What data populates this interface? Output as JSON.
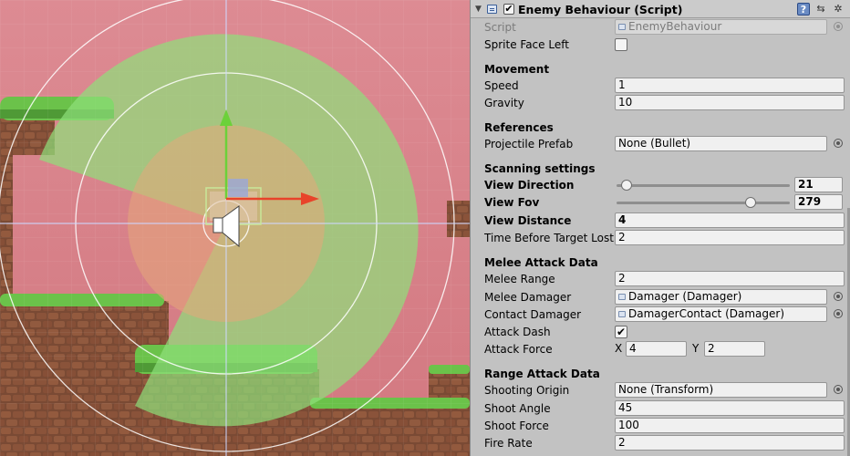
{
  "component": {
    "title": "Enemy Behaviour (Script)",
    "enabled": "✔",
    "help_icon": "?",
    "preset_icon": "⇆",
    "gear_icon": "✲"
  },
  "script": {
    "label": "Script",
    "value": "EnemyBehaviour"
  },
  "sprite_face_left": {
    "label": "Sprite Face Left",
    "checked": ""
  },
  "movement": {
    "header": "Movement",
    "speed": {
      "label": "Speed",
      "value": "1"
    },
    "gravity": {
      "label": "Gravity",
      "value": "10"
    }
  },
  "references": {
    "header": "References",
    "projectile_prefab": {
      "label": "Projectile Prefab",
      "value": "None (Bullet)"
    }
  },
  "scanning": {
    "header": "Scanning settings",
    "view_direction": {
      "label": "View Direction",
      "value": "21",
      "slider_fraction": 0.06
    },
    "view_fov": {
      "label": "View Fov",
      "value": "279",
      "slider_fraction": 0.775
    },
    "view_distance": {
      "label": "View Distance",
      "value": "4"
    },
    "time_before_target_lost": {
      "label": "Time Before Target Lost",
      "value": "2"
    }
  },
  "melee": {
    "header": "Melee Attack Data",
    "melee_range": {
      "label": "Melee Range",
      "value": "2"
    },
    "melee_damager": {
      "label": "Melee Damager",
      "value": "Damager (Damager)"
    },
    "contact_damager": {
      "label": "Contact Damager",
      "value": "DamagerContact (Damager)"
    },
    "attack_dash": {
      "label": "Attack Dash",
      "checked": "✔"
    },
    "attack_force": {
      "label": "Attack Force",
      "x_label": "X",
      "x": "4",
      "y_label": "Y",
      "y": "2"
    }
  },
  "range": {
    "header": "Range Attack Data",
    "shooting_origin": {
      "label": "Shooting Origin",
      "value": "None (Transform)"
    },
    "shoot_angle": {
      "label": "Shoot Angle",
      "value": "45"
    },
    "shoot_force": {
      "label": "Shoot Force",
      "value": "100"
    },
    "fire_rate": {
      "label": "Fire Rate",
      "value": "2"
    }
  },
  "colors": {
    "scene_bg": "#d9848c",
    "view_cone": "#8fe07a",
    "melee_disc": "#e0b07a",
    "gizmo_x": "#e8432a",
    "gizmo_y": "#6cd13a"
  }
}
